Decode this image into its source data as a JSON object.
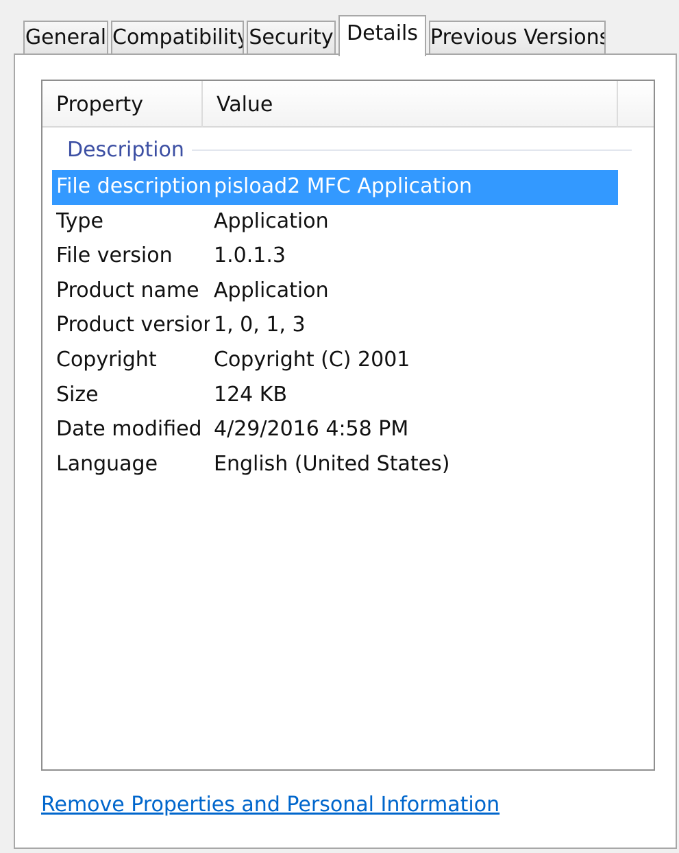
{
  "tabs": [
    {
      "label": "General"
    },
    {
      "label": "Compatibility"
    },
    {
      "label": "Security"
    },
    {
      "label": "Details"
    },
    {
      "label": "Previous Versions"
    }
  ],
  "active_tab": "Details",
  "columns": {
    "property": "Property",
    "value": "Value"
  },
  "group": {
    "label": "Description"
  },
  "rows": [
    {
      "property": "File description",
      "value": "pisload2 MFC Application",
      "selected": true
    },
    {
      "property": "Type",
      "value": "Application"
    },
    {
      "property": "File version",
      "value": "1.0.1.3"
    },
    {
      "property": "Product name",
      "value": "Application"
    },
    {
      "property": "Product version",
      "value": "1, 0, 1, 3"
    },
    {
      "property": "Copyright",
      "value": "Copyright (C) 2001"
    },
    {
      "property": "Size",
      "value": "124 KB"
    },
    {
      "property": "Date modified",
      "value": "4/29/2016 4:58 PM"
    },
    {
      "property": "Language",
      "value": "English (United States)"
    }
  ],
  "link": {
    "label": "Remove Properties and Personal Information"
  },
  "colors": {
    "selection": "#3399ff",
    "group_header": "#3c4fa3",
    "link": "#0066cc"
  }
}
